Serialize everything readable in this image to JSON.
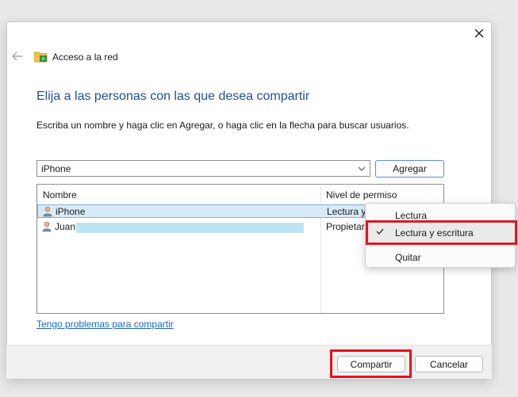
{
  "window": {
    "title": "Acceso a la red"
  },
  "heading": "Elija a las personas con las que desea compartir",
  "instruction": "Escriba un nombre y haga clic en Agregar, o haga clic en la flecha para buscar usuarios.",
  "combo": {
    "value": "iPhone"
  },
  "buttons": {
    "add": "Agregar",
    "share": "Compartir",
    "cancel": "Cancelar"
  },
  "table": {
    "columns": [
      "Nombre",
      "Nivel de permiso"
    ],
    "rows": [
      {
        "name": "iPhone",
        "permission": "Lectura y"
      },
      {
        "name": "Juan",
        "permission": "Propietar"
      }
    ]
  },
  "help_link": "Tengo problemas para compartir",
  "context_menu": {
    "items": [
      "Lectura",
      "Lectura y escritura",
      "Quitar"
    ],
    "checked": "Lectura y escritura"
  },
  "colors": {
    "heading": "#1f4e9c",
    "highlight": "#e8111d",
    "link": "#1a66c8",
    "selection": "#d9eaf9"
  },
  "icons": {
    "close": "close-icon",
    "back": "back-arrow-icon",
    "app": "network-folder-icon",
    "user": "user-icon",
    "dropdown": "chevron-down-icon",
    "check": "checkmark-icon"
  }
}
